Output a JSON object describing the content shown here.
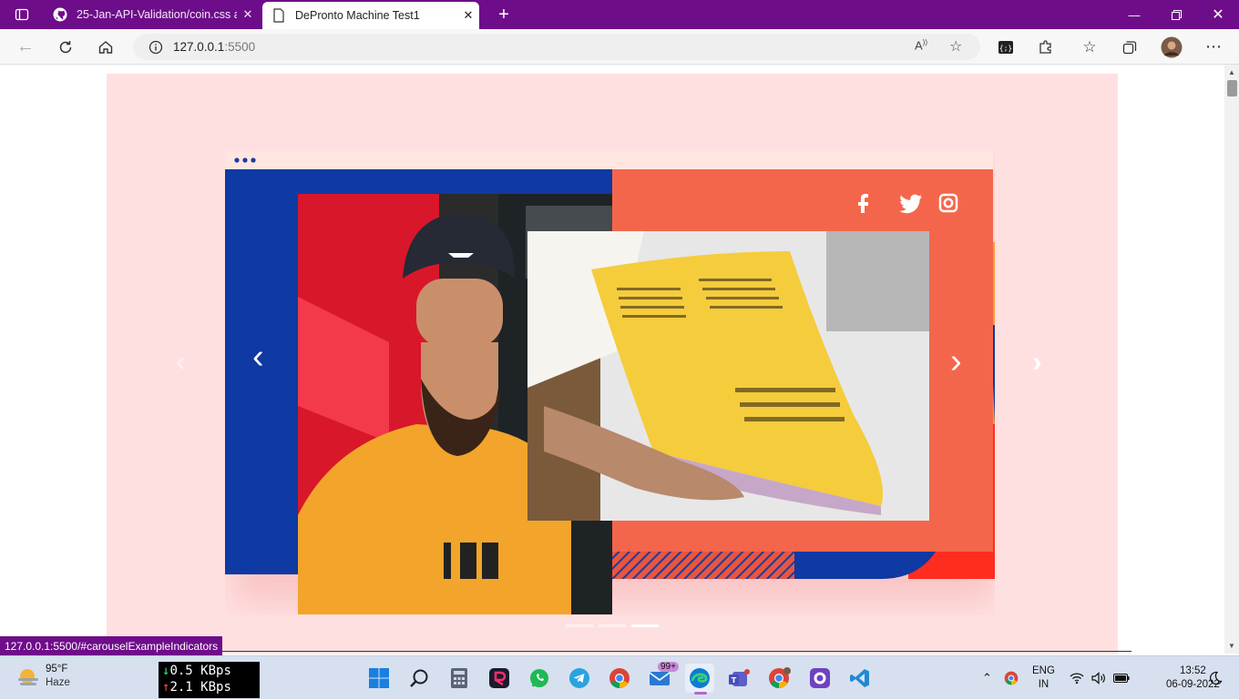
{
  "browser": {
    "tabs": [
      {
        "title": "25-Jan-API-Validation/coin.css at",
        "icon": "github-icon"
      },
      {
        "title": "DePronto Machine Test1",
        "icon": "page-icon"
      }
    ],
    "url_host": "127.0.0.1",
    "url_port": ":5500",
    "status_url": "127.0.0.1:5500/#carouselExampleIndicators",
    "accent": "#6e0d8a"
  },
  "carousel": {
    "prev_label": "‹",
    "next_label": "›",
    "indicators": [
      false,
      false,
      true
    ],
    "background": "#ffe0e0"
  },
  "taskbar": {
    "weather_temp": "95°F",
    "weather_desc": "Haze",
    "net_down": "0.5 KBps",
    "net_up": "2.1 KBps",
    "mail_badge": "99+",
    "lang": "ENG",
    "region": "IN",
    "time": "13:52",
    "date": "06-09-2022"
  }
}
